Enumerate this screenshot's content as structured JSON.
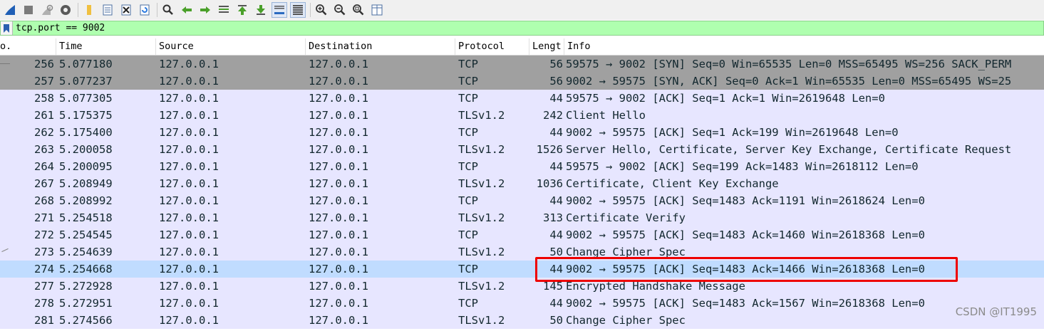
{
  "toolbar": {
    "icons": [
      "shark-fin-icon",
      "stop-square-icon",
      "restart-fin-icon",
      "options-gear-icon",
      "open-folder-icon",
      "save-file-icon",
      "close-file-icon",
      "reload-icon",
      "find-packet-icon",
      "go-back-icon",
      "go-forward-icon",
      "go-to-packet-icon",
      "go-first-icon",
      "go-last-icon",
      "autoscroll-icon",
      "colorize-icon",
      "zoom-in-icon",
      "zoom-out-icon",
      "zoom-normal-icon",
      "resize-columns-icon"
    ]
  },
  "filter": {
    "value": "tcp.port == 9002"
  },
  "columns": {
    "no": "o.",
    "time": "Time",
    "source": "Source",
    "destination": "Destination",
    "protocol": "Protocol",
    "length": "Lengt",
    "info": "Info"
  },
  "rows": [
    {
      "no": "256",
      "time": "5.077180",
      "source": "127.0.0.1",
      "destination": "127.0.0.1",
      "protocol": "TCP",
      "length": "56",
      "info": "59575 → 9002 [SYN] Seq=0 Win=65535 Len=0 MSS=65495 WS=256 SACK_PERM"
    },
    {
      "no": "257",
      "time": "5.077237",
      "source": "127.0.0.1",
      "destination": "127.0.0.1",
      "protocol": "TCP",
      "length": "56",
      "info": "9002 → 59575 [SYN, ACK] Seq=0 Ack=1 Win=65535 Len=0 MSS=65495 WS=25"
    },
    {
      "no": "258",
      "time": "5.077305",
      "source": "127.0.0.1",
      "destination": "127.0.0.1",
      "protocol": "TCP",
      "length": "44",
      "info": "59575 → 9002 [ACK] Seq=1 Ack=1 Win=2619648 Len=0"
    },
    {
      "no": "261",
      "time": "5.175375",
      "source": "127.0.0.1",
      "destination": "127.0.0.1",
      "protocol": "TLSv1.2",
      "length": "242",
      "info": "Client Hello"
    },
    {
      "no": "262",
      "time": "5.175400",
      "source": "127.0.0.1",
      "destination": "127.0.0.1",
      "protocol": "TCP",
      "length": "44",
      "info": "9002 → 59575 [ACK] Seq=1 Ack=199 Win=2619648 Len=0"
    },
    {
      "no": "263",
      "time": "5.200058",
      "source": "127.0.0.1",
      "destination": "127.0.0.1",
      "protocol": "TLSv1.2",
      "length": "1526",
      "info": "Server Hello, Certificate, Server Key Exchange, Certificate Request"
    },
    {
      "no": "264",
      "time": "5.200095",
      "source": "127.0.0.1",
      "destination": "127.0.0.1",
      "protocol": "TCP",
      "length": "44",
      "info": "59575 → 9002 [ACK] Seq=199 Ack=1483 Win=2618112 Len=0"
    },
    {
      "no": "267",
      "time": "5.208949",
      "source": "127.0.0.1",
      "destination": "127.0.0.1",
      "protocol": "TLSv1.2",
      "length": "1036",
      "info": "Certificate, Client Key Exchange"
    },
    {
      "no": "268",
      "time": "5.208992",
      "source": "127.0.0.1",
      "destination": "127.0.0.1",
      "protocol": "TCP",
      "length": "44",
      "info": "9002 → 59575 [ACK] Seq=1483 Ack=1191 Win=2618624 Len=0"
    },
    {
      "no": "271",
      "time": "5.254518",
      "source": "127.0.0.1",
      "destination": "127.0.0.1",
      "protocol": "TLSv1.2",
      "length": "313",
      "info": "Certificate Verify"
    },
    {
      "no": "272",
      "time": "5.254545",
      "source": "127.0.0.1",
      "destination": "127.0.0.1",
      "protocol": "TCP",
      "length": "44",
      "info": "9002 → 59575 [ACK] Seq=1483 Ack=1460 Win=2618368 Len=0"
    },
    {
      "no": "273",
      "time": "5.254639",
      "source": "127.0.0.1",
      "destination": "127.0.0.1",
      "protocol": "TLSv1.2",
      "length": "50",
      "info": "Change Cipher Spec"
    },
    {
      "no": "274",
      "time": "5.254668",
      "source": "127.0.0.1",
      "destination": "127.0.0.1",
      "protocol": "TCP",
      "length": "44",
      "info": "9002 → 59575 [ACK] Seq=1483 Ack=1466 Win=2618368 Len=0"
    },
    {
      "no": "277",
      "time": "5.272928",
      "source": "127.0.0.1",
      "destination": "127.0.0.1",
      "protocol": "TLSv1.2",
      "length": "145",
      "info": "Encrypted Handshake Message"
    },
    {
      "no": "278",
      "time": "5.272951",
      "source": "127.0.0.1",
      "destination": "127.0.0.1",
      "protocol": "TCP",
      "length": "44",
      "info": "9002 → 59575 [ACK] Seq=1483 Ack=1567 Win=2618368 Len=0"
    },
    {
      "no": "281",
      "time": "5.274566",
      "source": "127.0.0.1",
      "destination": "127.0.0.1",
      "protocol": "TLSv1.2",
      "length": "50",
      "info": "Change Cipher Spec"
    }
  ],
  "row_colors": {
    "syn": "#a0a0a0",
    "tcp": "#e7e6ff",
    "selected": "#c0dcff",
    "text": "#12272e"
  },
  "selected_row": "274",
  "watermark": "CSDN @IT1995"
}
